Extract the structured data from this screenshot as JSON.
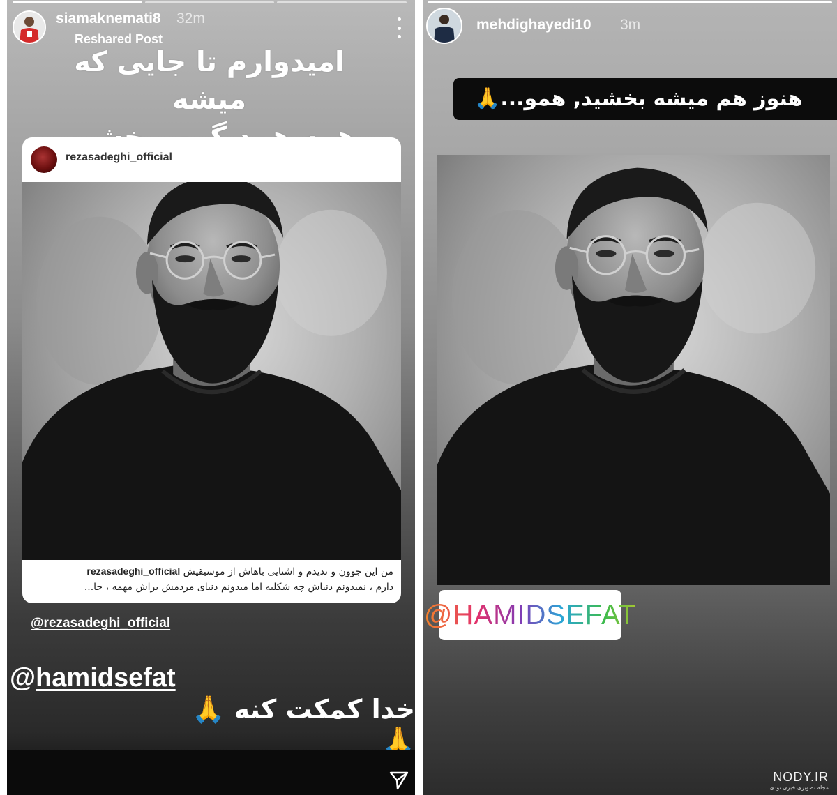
{
  "left_story": {
    "username": "siamaknemati8",
    "time": "32m",
    "reshared_label": "Reshared Post",
    "caption_line1": "امیدوارم تا جایی که میشه",
    "caption_line2": "همه همدیگرو ببخشیم",
    "post": {
      "username": "rezasadeghi_official",
      "caption_user": "rezasadeghi_official",
      "caption_line1": "من این جوون و ندیدم و اشنایی باهاش از موسیقیش",
      "caption_line2": "دارم ، نمیدونم دنیاش چه شکلیه اما میدونم دنیای مردمش براش مهمه ، حا..."
    },
    "mention_small": "@rezasadeghi_official",
    "mention_big_at": "@",
    "mention_big_name": "hamidsefat",
    "prayer_text": "خدا کمکت کنه",
    "prayer_emoji": "🙏🙏"
  },
  "right_story": {
    "username": "mehdighayedi10",
    "time": "3m",
    "banner_text": "هنوز هم میشه بخشید, همو...🙏",
    "mention_sticker": "@HAMIDSEFAT"
  },
  "watermark": {
    "main": "NODY.IR",
    "sub": "مجله تصویری خبری نودی"
  },
  "icons": {
    "more": "more-vertical-icon",
    "send": "send-icon"
  },
  "colors": {
    "card_bg": "#ffffff",
    "banner_bg": "#0c0c0c",
    "text_white": "#ffffff"
  }
}
